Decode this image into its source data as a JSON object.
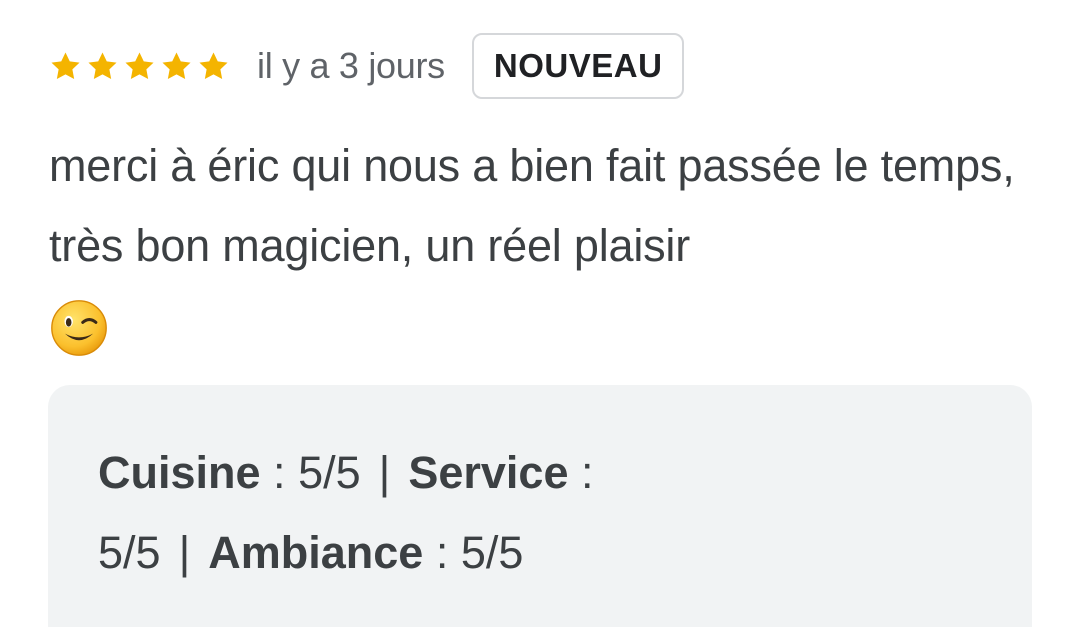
{
  "review": {
    "rating": 5,
    "rating_max": 5,
    "star_color": "#f4b400",
    "date_text": "il y a 3 jours",
    "badge_label": "NOUVEAU",
    "body_text": "merci à éric qui nous a bien fait passée le temps, très bon magicien, un réel plaisir",
    "emoji": "winking-face-emoji"
  },
  "ratings": [
    {
      "category": "Cuisine",
      "separator": " : ",
      "score": "5/5"
    },
    {
      "category": "Service",
      "separator": " : ",
      "score": "5/5"
    },
    {
      "category": "Ambiance",
      "separator": " : ",
      "score": "5/5"
    }
  ],
  "ratings_divider": "|"
}
